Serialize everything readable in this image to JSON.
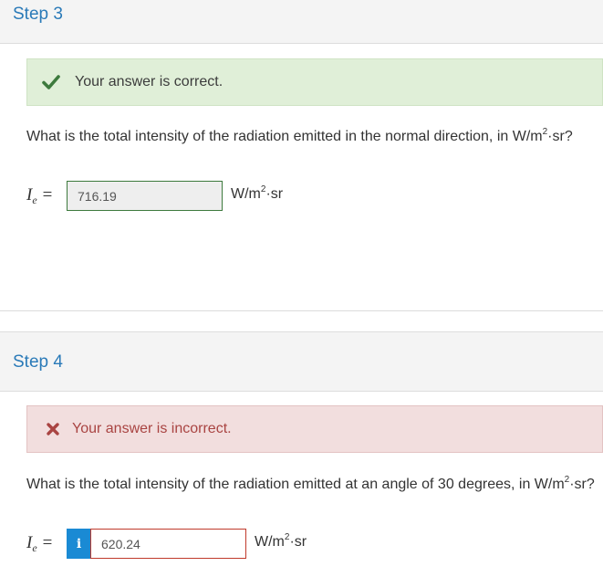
{
  "step3": {
    "title": "Step 3",
    "feedback": "Your answer is correct.",
    "question_prefix": "What is the total intensity of the radiation emitted in the normal direction, in W/m",
    "question_sup": "2",
    "question_suffix": "·sr?",
    "variable": "I",
    "variable_sub": "e",
    "equals": "=",
    "answer_value": "716.19",
    "unit_prefix": "W/m",
    "unit_sup": "2",
    "unit_suffix": "·sr"
  },
  "step4": {
    "title": "Step 4",
    "feedback": "Your answer is incorrect.",
    "question_prefix": "What is the total intensity of the radiation emitted at an angle of 30 degrees, in W/m",
    "question_sup": "2",
    "question_suffix": "·sr?",
    "variable": "I",
    "variable_sub": "e",
    "equals": "=",
    "info_label": "i",
    "answer_value": "620.24",
    "unit_prefix": "W/m",
    "unit_sup": "2",
    "unit_suffix": "·sr"
  },
  "colors": {
    "accent": "#2a7ab8",
    "correct_bg": "#e0efd8",
    "correct_icon": "#3d7a3d",
    "incorrect_bg": "#f2dede",
    "incorrect_text": "#a94442",
    "info_button": "#1a8ad4"
  },
  "icons": {
    "correct": "checkmark-icon",
    "incorrect": "x-mark-icon",
    "info": "info-icon"
  }
}
